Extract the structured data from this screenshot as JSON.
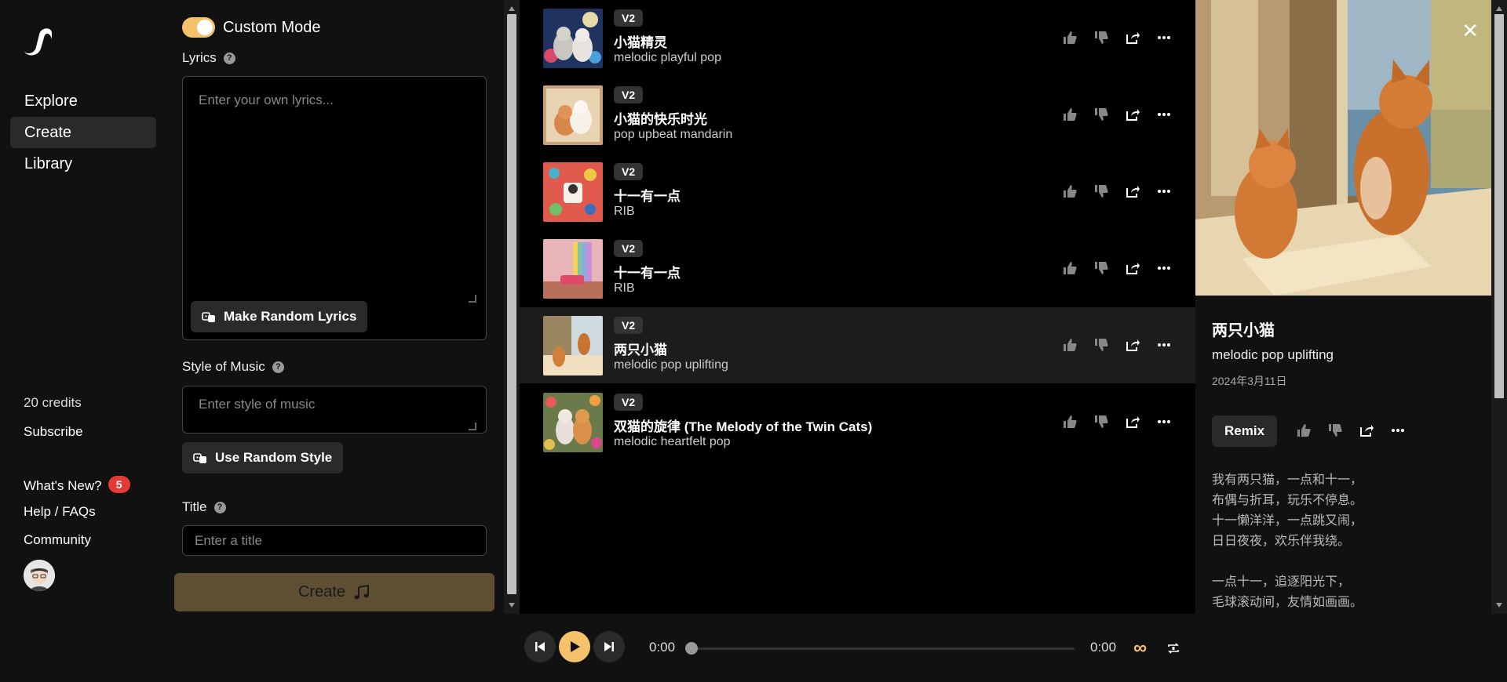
{
  "nav": {
    "explore": "Explore",
    "create": "Create",
    "library": "Library"
  },
  "sidebar": {
    "credits": "20 credits",
    "subscribe": "Subscribe",
    "whats_new": "What's New?",
    "whats_new_count": "5",
    "help": "Help / FAQs",
    "community": "Community"
  },
  "create_panel": {
    "mode_label": "Custom Mode",
    "lyrics_label": "Lyrics",
    "lyrics_placeholder": "Enter your own lyrics...",
    "random_lyrics_btn": "Make Random Lyrics",
    "style_label": "Style of Music",
    "style_placeholder": "Enter style of music",
    "random_style_btn": "Use Random Style",
    "title_label": "Title",
    "title_placeholder": "Enter a title",
    "create_btn": "Create"
  },
  "songs": [
    {
      "version": "V2",
      "title": "小猫精灵",
      "style": "melodic playful pop"
    },
    {
      "version": "V2",
      "title": "小猫的快乐时光",
      "style": "pop upbeat mandarin"
    },
    {
      "version": "V2",
      "title": "十一有一点",
      "style": "RIB"
    },
    {
      "version": "V2",
      "title": "十一有一点",
      "style": "RIB"
    },
    {
      "version": "V2",
      "title": "两只小猫",
      "style": "melodic pop uplifting"
    },
    {
      "version": "V2",
      "title": "双猫的旋律 (The Melody of the Twin Cats)",
      "style": "melodic heartfelt pop"
    }
  ],
  "detail": {
    "title": "两只小猫",
    "style": "melodic pop uplifting",
    "date": "2024年3月11日",
    "remix": "Remix",
    "lyrics": "我有两只猫，一点和十一，\n布偶与折耳，玩乐不停息。\n十一懒洋洋，一点跳又闹，\n日日夜夜，欢乐伴我绕。\n\n一点十一，追逐阳光下，\n毛球滚动间，友情如画画。"
  },
  "player": {
    "current_time": "0:00",
    "duration": "0:00",
    "progress": 0,
    "loop_symbol": "∞"
  },
  "colors": {
    "accent": "#f5c26b",
    "badge": "#e53935"
  }
}
